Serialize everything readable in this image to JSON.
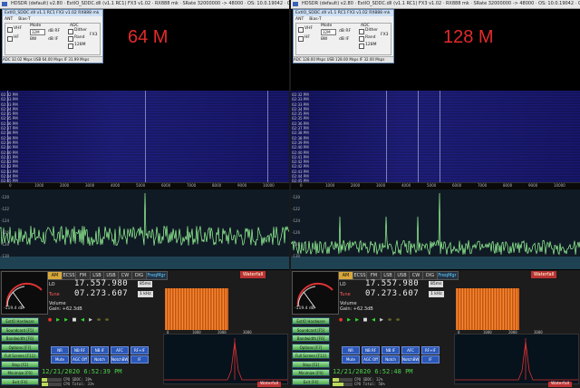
{
  "panes": [
    {
      "id": "left",
      "window_title": "HDSDR  (default)  v2.80  ·  ExtIO_SDDC.dll (v1.1 RC1)  FX3 v1.02  ·  RX888 mk  ·  SRate 32000000 -> 48000  ·  OS: 10.0.19042  ·  CPU: Intel Core i7-8665U @ 1.90GHz  ·  RAM: 16124MB",
      "extio_title": "ExtIO_SDDC.dll v1.1 RC1  FX3 v1.02  RX888 mk",
      "extio_tabs": [
        "ANT",
        "Bias-T"
      ],
      "extio_checkboxes": [
        "VHF",
        "HF"
      ],
      "extio_mode_label": "Mode",
      "extio_mode_value": "32M",
      "extio_bw_label": "BW",
      "extio_rf_label": "dB RF",
      "extio_if_label": "dB IF",
      "extio_adc_label": "ADC",
      "extio_adc_opts": [
        "Dither",
        "Rand",
        "128M"
      ],
      "extio_fx3_label": "FX3",
      "extio_status": "ADC   32.02 Msps   USB   64.00 Msps   IF   31.99 Msps",
      "big_label": "64 M",
      "waterfall_times": [
        "02:32 PM",
        "02:33 PM",
        "02:33 PM",
        "02:34 PM",
        "02:35 PM",
        "02:35 PM",
        "02:36 PM",
        "02:37 PM",
        "02:38 PM",
        "02:38 PM",
        "02:39 PM",
        "02:40 PM",
        "02:40 PM",
        "02:41 PM",
        "02:42 PM",
        "02:42 PM",
        "02:43 PM",
        "02:44 PM",
        "02:45 PM"
      ],
      "axis_ticks": [
        "0",
        "1000",
        "2000",
        "3000",
        "4000",
        "5000",
        "6000",
        "7000",
        "8000",
        "9000",
        "10000"
      ],
      "db_ticks": [
        "-120",
        "-122",
        "-124",
        "-126",
        "-128",
        "-130"
      ],
      "lo_label": "LO",
      "lo_value": "17.557.980",
      "lo_unit": "85ms",
      "tune_label": "Tune",
      "tune_value": "07.273.607",
      "tune_unit": "1 kHz",
      "volume_label": "Volume",
      "gain_text": "Gain: +62.3dB",
      "smeter_value": "-119.4 dB",
      "modes": [
        "AM",
        "ECSS",
        "FM",
        "LSB",
        "USB",
        "CW",
        "DIG",
        "FreqMgr"
      ],
      "active_mode": "AM",
      "waterfall_btn": "Waterfall",
      "side_buttons": [
        "ExtIO Hardware [F8]",
        "Soundcard [F5]",
        "Bandwidth [F6]",
        "Options [F7]",
        "Full Screen [F11]",
        "Stop [F2]",
        "Minimize [F9]",
        "Exit [F4]"
      ],
      "nr_buttons": [
        "NR",
        "NB RF",
        "NB IF",
        "AFC",
        "RF+IF",
        "Mute",
        "AGC Off",
        "Notch",
        "NotchBW",
        "IF"
      ],
      "clock": "12/21/2020  6:52:39 PM",
      "cpu_sddc": "CPU SDDC: 28%",
      "cpu_total": "CPU Total: 31%",
      "cpu_sddc_frac": 0.28,
      "cpu_total_frac": 0.31,
      "small_axis": [
        "0",
        "1000",
        "2000",
        "3000"
      ]
    },
    {
      "id": "right",
      "window_title": "HDSDR  (default)  v2.80  ·  ExtIO_SDDC.dll (v1.1 RC1)  FX3 v1.02  ·  RX888 mk  ·  SRate 32000000 -> 48000  ·  OS: 10.0.19042  ·  CPU: Intel Core i7-8665U @ 1.90GHz  ·  RAM: 16124MB",
      "extio_title": "ExtIO_SDDC.dll v1.1 RC1  FX3 v1.02  RX888 mk",
      "extio_tabs": [
        "ANT",
        "Bias-T"
      ],
      "extio_checkboxes": [
        "VHF",
        "HF"
      ],
      "extio_mode_label": "Mode",
      "extio_mode_value": "32M",
      "extio_bw_label": "BW",
      "extio_rf_label": "dB RF",
      "extio_if_label": "dB IF",
      "extio_adc_label": "ADC",
      "extio_adc_opts": [
        "Dither",
        "Rand",
        "128M"
      ],
      "extio_fx3_label": "FX3",
      "extio_status": "ADC   128.00 Msps   USB   128.00 Msps   IF   32.00 Msps",
      "big_label": "128 M",
      "waterfall_times": [
        "02:32 PM",
        "02:33 PM",
        "02:33 PM",
        "02:34 PM",
        "02:35 PM",
        "02:35 PM",
        "02:36 PM",
        "02:37 PM",
        "02:38 PM",
        "02:38 PM",
        "02:39 PM",
        "02:40 PM",
        "02:40 PM",
        "02:41 PM",
        "02:42 PM",
        "02:42 PM",
        "02:43 PM",
        "02:44 PM",
        "02:45 PM"
      ],
      "axis_ticks": [
        "0",
        "1000",
        "2000",
        "3000",
        "4000",
        "5000",
        "6000",
        "7000",
        "8000",
        "9000",
        "10000"
      ],
      "db_ticks": [
        "-120",
        "-122",
        "-124",
        "-126",
        "-128",
        "-130"
      ],
      "lo_label": "LO",
      "lo_value": "17.557.980",
      "lo_unit": "85ms",
      "tune_label": "Tune",
      "tune_value": "07.273.607",
      "tune_unit": "1 kHz",
      "volume_label": "Volume",
      "gain_text": "Gain: +62.3dB",
      "smeter_value": "-119.4 dB",
      "modes": [
        "AM",
        "ECSS",
        "FM",
        "LSB",
        "USB",
        "CW",
        "DIG",
        "FreqMgr"
      ],
      "active_mode": "AM",
      "waterfall_btn": "Waterfall",
      "side_buttons": [
        "ExtIO Hardware [F8]",
        "Soundcard [F5]",
        "Bandwidth [F6]",
        "Options [F7]",
        "Full Screen [F11]",
        "Stop [F2]",
        "Minimize [F9]",
        "Exit [F4]"
      ],
      "nr_buttons": [
        "NR",
        "NB RF",
        "NB IF",
        "AFC",
        "RF+IF",
        "Mute",
        "AGC Off",
        "Notch",
        "NotchBW",
        "IF"
      ],
      "clock": "12/21/2020  6:52:48 PM",
      "cpu_sddc": "CPU SDDC: 32%",
      "cpu_total": "CPU Total: 56%",
      "cpu_sddc_frac": 0.32,
      "cpu_total_frac": 0.56,
      "small_axis": [
        "0",
        "1000",
        "2000",
        "3000"
      ]
    }
  ],
  "colors": {
    "waterfall_bg": "#0c0c48",
    "spectrum_trace": "#9bff9b",
    "label_red": "#e42a2a",
    "active_mode": "#d8a83a",
    "button_blue": "#2b58b8",
    "clock_green": "#4cd24c"
  }
}
